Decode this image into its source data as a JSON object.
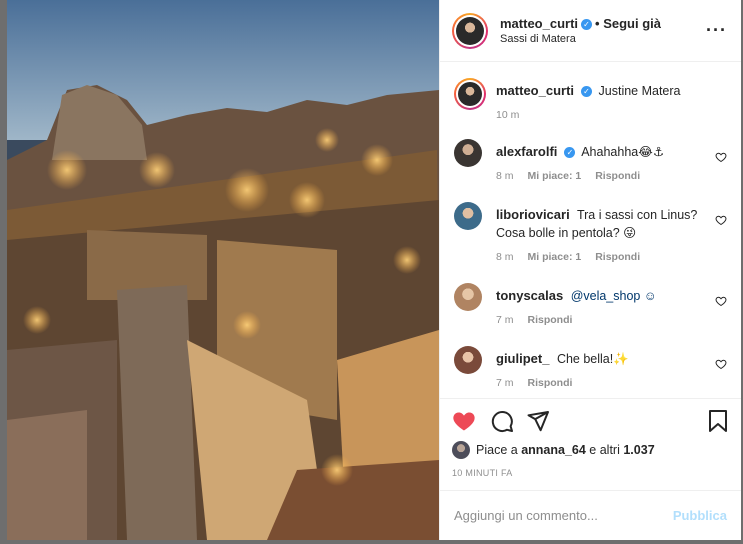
{
  "header": {
    "username": "matteo_curti",
    "follow_label": "• Segui già",
    "location": "Sassi di Matera"
  },
  "caption": {
    "username": "matteo_curti",
    "text": "Justine Matera",
    "time": "10 m"
  },
  "comments": [
    {
      "username": "alexfarolfi",
      "verified": true,
      "text": "Ahahahha😂⚓",
      "time": "8 m",
      "likes": "Mi piace: 1",
      "reply": "Rispondi",
      "avatar_color": "#5a4e48"
    },
    {
      "username": "liboriovicari",
      "verified": false,
      "text": "Tra i sassi con Linus? Cosa bolle in pentola? 😜",
      "time": "8 m",
      "likes": "Mi piace: 1",
      "reply": "Rispondi",
      "avatar_color": "#3d6b8a"
    },
    {
      "username": "tonyscalas",
      "verified": false,
      "text": "@vela_shop ☺",
      "time": "7 m",
      "likes": "",
      "reply": "Rispondi",
      "avatar_color": "#c9a27a"
    },
    {
      "username": "giulipet_",
      "verified": false,
      "text": "Che bella!✨",
      "time": "7 m",
      "likes": "",
      "reply": "Rispondi",
      "avatar_color": "#8a5a4a"
    }
  ],
  "likes": {
    "prefix": "Piace a",
    "user": "annana_64",
    "suffix": "e altri",
    "count": "1.037"
  },
  "posted": "10 MINUTI FA",
  "add_comment": {
    "placeholder": "Aggiungi un commento...",
    "publish_label": "Pubblica"
  },
  "colors": {
    "heart": "#ed4956",
    "verified": "#3897f0",
    "publish_disabled": "#b2dffc"
  }
}
